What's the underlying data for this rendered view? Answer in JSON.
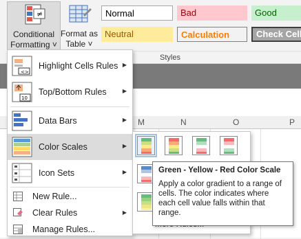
{
  "ribbon": {
    "conditional_formatting_line1": "Conditional",
    "conditional_formatting_line2": "Formatting ˅",
    "format_as_table_line1": "Format as",
    "format_as_table_line2": "Table ˅",
    "styles_group_label": "Styles",
    "styles": {
      "normal": "Normal",
      "bad": "Bad",
      "good": "Good",
      "neutral": "Neutral",
      "calculation": "Calculation",
      "check_cell": "Check Cell"
    }
  },
  "columns": [
    "M",
    "N",
    "O",
    "P"
  ],
  "menu": {
    "items": [
      {
        "label": "Highlight Cells Rules",
        "icon": "highlight-cells-rules-icon",
        "submenu": true
      },
      {
        "label": "Top/Bottom Rules",
        "icon": "top-bottom-rules-icon",
        "submenu": true
      },
      {
        "label": "Data Bars",
        "icon": "data-bars-icon",
        "submenu": true
      },
      {
        "label": "Color Scales",
        "icon": "color-scales-icon",
        "submenu": true,
        "highlighted": true
      },
      {
        "label": "Icon Sets",
        "icon": "icon-sets-icon",
        "submenu": true
      },
      {
        "label": "New Rule...",
        "icon": "new-rule-icon",
        "submenu": false
      },
      {
        "label": "Clear Rules",
        "icon": "clear-rules-icon",
        "submenu": true
      },
      {
        "label": "Manage Rules...",
        "icon": "manage-rules-icon",
        "submenu": false
      }
    ]
  },
  "submenu": {
    "more_rules": "More Rules...",
    "swatches": [
      {
        "name": "green-yellow-red",
        "colors": [
          "#63be7b",
          "#cddd82",
          "#ffeb84",
          "#fbaa77",
          "#f8696b"
        ]
      },
      {
        "name": "red-yellow-green",
        "colors": [
          "#f8696b",
          "#fbaa77",
          "#ffeb84",
          "#cddd82",
          "#63be7b"
        ]
      },
      {
        "name": "green-white-red",
        "colors": [
          "#63be7b",
          "#b1dfbd",
          "#fcfcff",
          "#fbb8ba",
          "#f8696b"
        ]
      },
      {
        "name": "red-white-green",
        "colors": [
          "#f8696b",
          "#fbb8ba",
          "#fcfcff",
          "#b1dfbd",
          "#63be7b"
        ]
      }
    ]
  },
  "tooltip": {
    "title": "Green - Yellow - Red Color Scale",
    "body": "Apply a color gradient to a range of cells. The color indicates where each cell value falls within that range."
  }
}
